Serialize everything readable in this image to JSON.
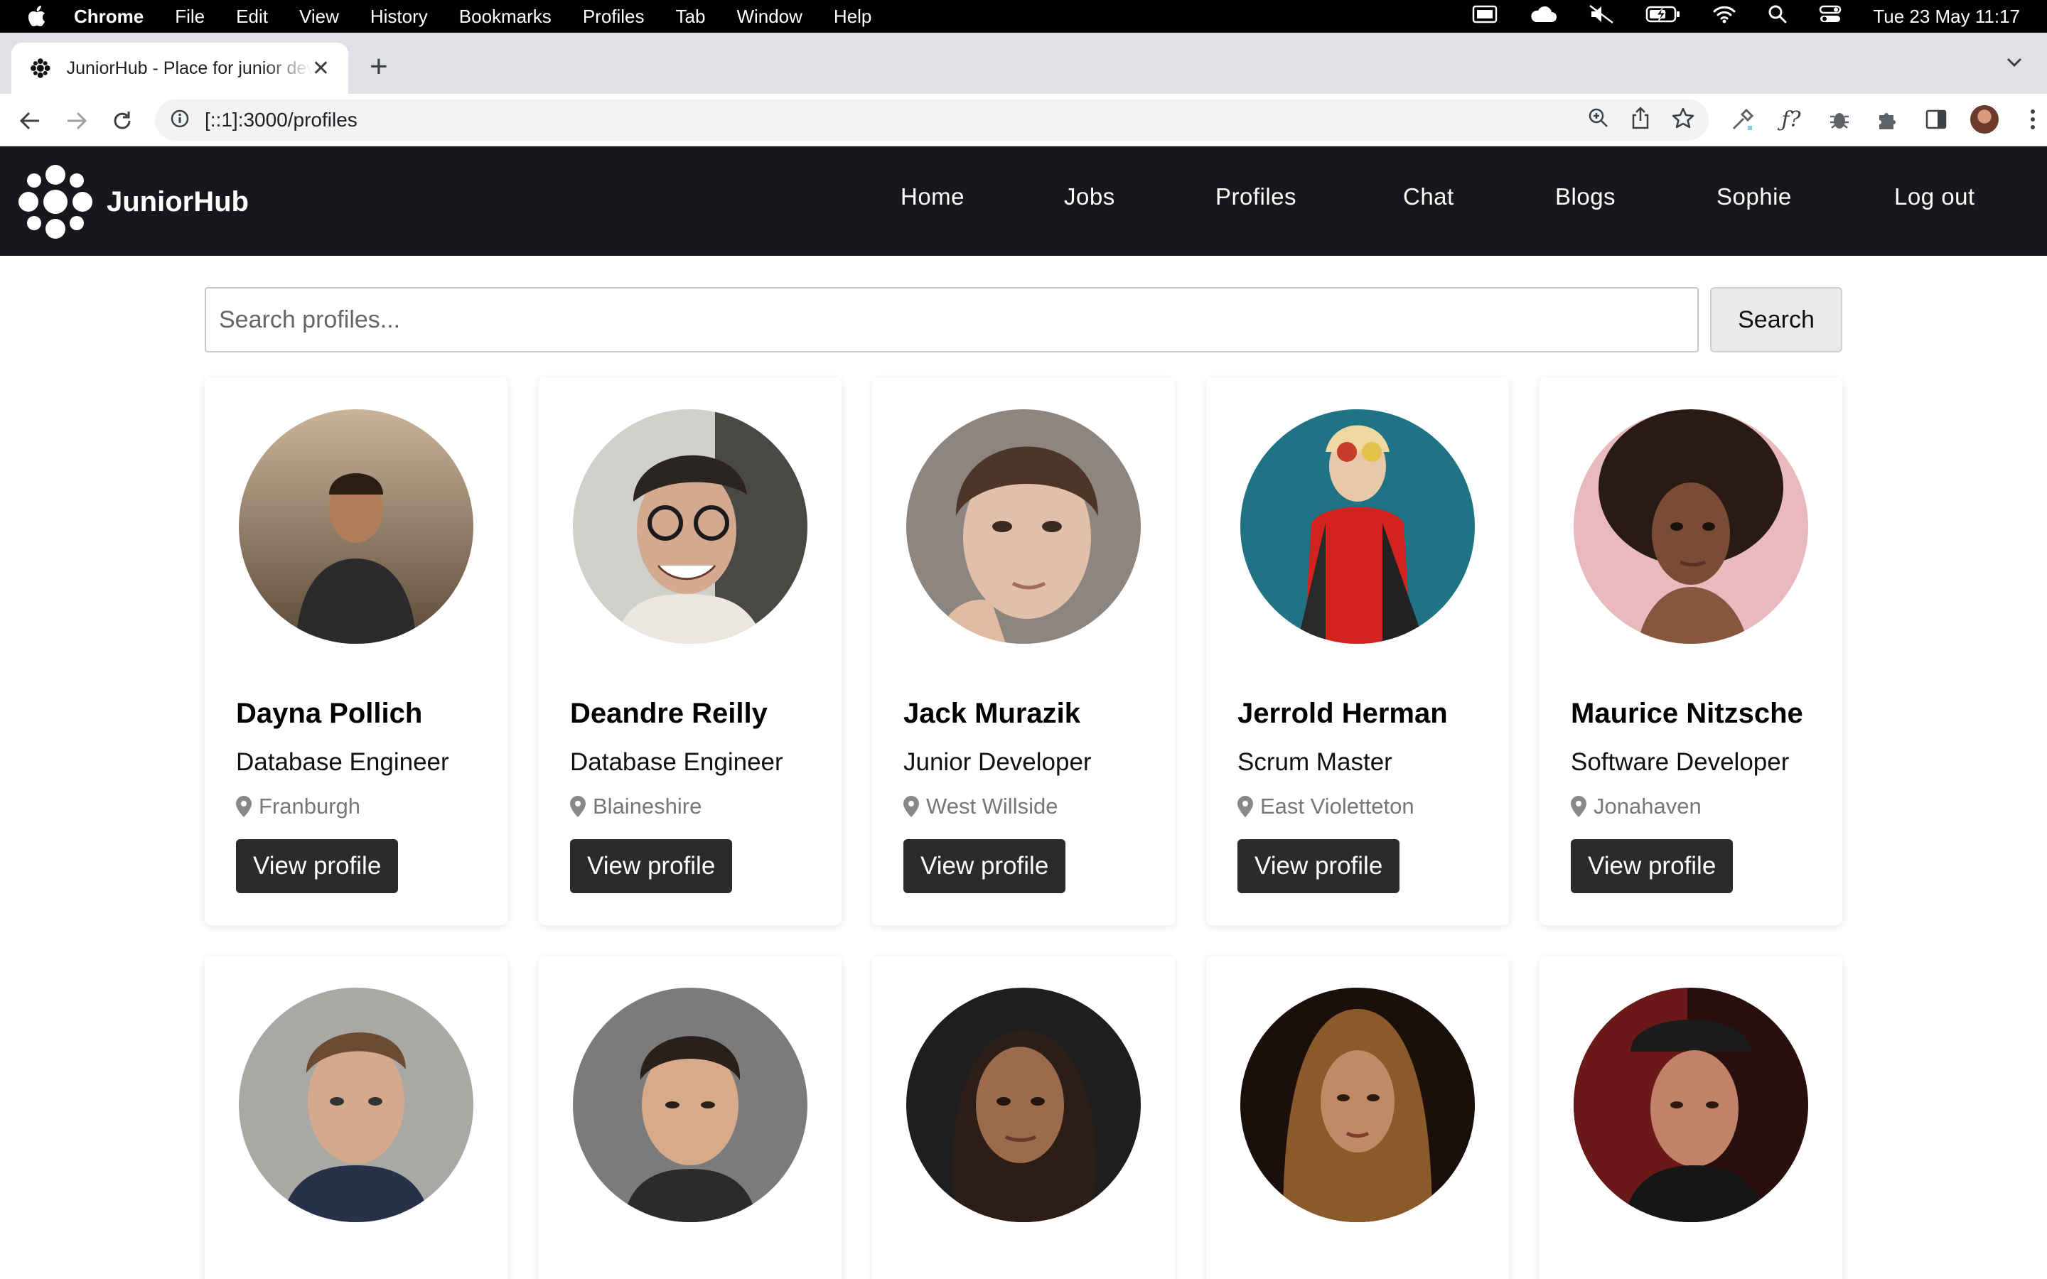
{
  "menubar": {
    "app": "Chrome",
    "items": [
      "File",
      "Edit",
      "View",
      "History",
      "Bookmarks",
      "Profiles",
      "Tab",
      "Window",
      "Help"
    ],
    "clock": "Tue 23 May  11:17",
    "icons": [
      "display-icon",
      "cloud-icon",
      "mute-icon",
      "battery-icon",
      "wifi-icon",
      "search-icon",
      "control-center-icon"
    ]
  },
  "browser": {
    "tab_title": "JuniorHub - Place for junior developers",
    "url": "[::1]:3000/profiles",
    "extension_icons": [
      "eyedropper-icon",
      "function-icon",
      "bug-icon",
      "puzzle-icon",
      "sidepanel-icon",
      "profile-avatar",
      "kebab-menu-icon"
    ]
  },
  "site": {
    "brand": "JuniorHub",
    "nav": [
      "Home",
      "Jobs",
      "Profiles",
      "Chat",
      "Blogs",
      "Sophie",
      "Log out"
    ]
  },
  "search": {
    "placeholder": "Search profiles...",
    "button": "Search"
  },
  "profiles": [
    {
      "name": "Dayna Pollich",
      "role": "Database Engineer",
      "location": "Franburgh",
      "button": "View profile"
    },
    {
      "name": "Deandre Reilly",
      "role": "Database Engineer",
      "location": "Blaineshire",
      "button": "View profile"
    },
    {
      "name": "Jack Murazik",
      "role": "Junior Developer",
      "location": "West Willside",
      "button": "View profile"
    },
    {
      "name": "Jerrold Herman",
      "role": "Scrum Master",
      "location": "East Violetteton",
      "button": "View profile"
    },
    {
      "name": "Maurice Nitzsche",
      "role": "Software Developer",
      "location": "Jonahaven",
      "button": "View profile"
    }
  ],
  "colors": {
    "navbar": "#16181c",
    "button_dark": "#2b2b2b",
    "muted_text": "#777777"
  }
}
